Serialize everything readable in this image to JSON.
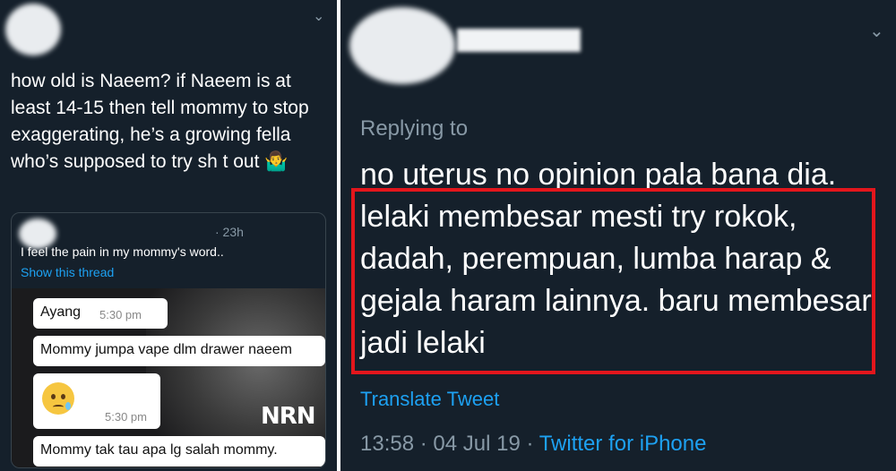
{
  "left_tweet": {
    "text": "how old is Naeem? if Naeem is at least 14-15 then tell mommy to stop exaggerating, he’s a growing fella who’s supposed to try sh t out 🤷‍♂️",
    "quote": {
      "time": "· 23h",
      "text": "I feel the pain in my mommy's word..",
      "show_thread": "Show this thread",
      "messages": [
        {
          "text": "Ayang",
          "time": "5:30 pm"
        },
        {
          "text": "Mommy jumpa vape dlm drawer naeem"
        },
        {
          "emoji": "crying-face",
          "time": "5:30 pm"
        },
        {
          "text": "Mommy tak tau apa lg salah mommy."
        }
      ],
      "image_logo": "NRN"
    }
  },
  "right_tweet": {
    "replying_to": "Replying to",
    "text": "no uterus no opinion pala bana dia. lelaki membesar mesti try rokok, dadah, perempuan, lumba harap & gejala haram lainnya. baru membesar jadi lelaki",
    "translate": "Translate Tweet",
    "time": "13:58",
    "separator1": "·",
    "date": "04 Jul 19",
    "separator2": "·",
    "client": "Twitter for iPhone"
  },
  "colors": {
    "background": "#15202b",
    "secondary_text": "#8899a6",
    "link": "#1da1f2",
    "highlight_border": "#e3161c"
  }
}
